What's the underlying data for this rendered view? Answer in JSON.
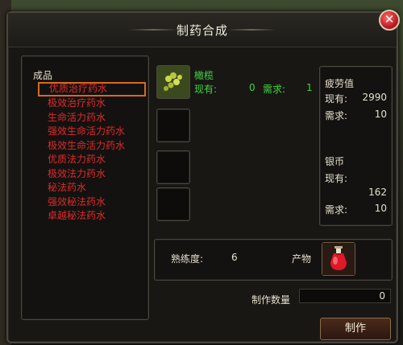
{
  "dialog": {
    "title": "制药合成",
    "close_symbol": "✕"
  },
  "recipes": {
    "header": "成品",
    "items": [
      "优质治疗药水",
      "极效治疗药水",
      "生命活力药水",
      "强效生命活力药水",
      "极效生命活力药水",
      "优质法力药水",
      "极效法力药水",
      "秘法药水",
      "强效秘法药水",
      "卓越秘法药水"
    ],
    "selected_index": 0
  },
  "material": {
    "name": "橄榄",
    "owned_label": "现有:",
    "owned_value": "0",
    "required_label": "需求:",
    "required_value": "1",
    "icon": "olive-branch-icon"
  },
  "info": {
    "fatigue_title": "疲劳值",
    "fatigue_owned_label": "现有:",
    "fatigue_owned_value": "2990",
    "fatigue_required_label": "需求:",
    "fatigue_required_value": "10",
    "silver_title": "银币",
    "silver_owned_label": "现有:",
    "silver_owned_value": "162",
    "silver_required_label": "需求:",
    "silver_required_value": "10"
  },
  "production": {
    "proficiency_label": "熟练度:",
    "proficiency_value": "6",
    "product_label": "产物",
    "product_icon": "red-potion-icon",
    "quantity_label": "制作数量",
    "quantity_value": "0",
    "craft_button": "制作"
  },
  "colors": {
    "recipe_text": "#e02a2a",
    "material_text": "#3fd43f",
    "selection_border": "#d76a1c"
  }
}
